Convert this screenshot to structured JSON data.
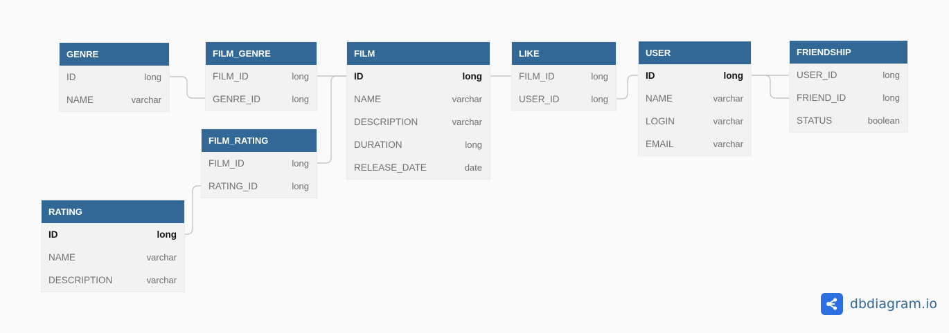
{
  "tables": {
    "genre": {
      "name": "GENRE",
      "fields": [
        {
          "name": "ID",
          "type": "long"
        },
        {
          "name": "NAME",
          "type": "varchar"
        }
      ]
    },
    "film_genre": {
      "name": "FILM_GENRE",
      "fields": [
        {
          "name": "FILM_ID",
          "type": "long"
        },
        {
          "name": "GENRE_ID",
          "type": "long"
        }
      ]
    },
    "film_rating": {
      "name": "FILM_RATING",
      "fields": [
        {
          "name": "FILM_ID",
          "type": "long"
        },
        {
          "name": "RATING_ID",
          "type": "long"
        }
      ]
    },
    "rating": {
      "name": "RATING",
      "fields": [
        {
          "name": "ID",
          "type": "long"
        },
        {
          "name": "NAME",
          "type": "varchar"
        },
        {
          "name": "DESCRIPTION",
          "type": "varchar"
        }
      ]
    },
    "film": {
      "name": "FILM",
      "fields": [
        {
          "name": "ID",
          "type": "long"
        },
        {
          "name": "NAME",
          "type": "varchar"
        },
        {
          "name": "DESCRIPTION",
          "type": "varchar"
        },
        {
          "name": "DURATION",
          "type": "long"
        },
        {
          "name": "RELEASE_DATE",
          "type": "date"
        }
      ]
    },
    "like": {
      "name": "LIKE",
      "fields": [
        {
          "name": "FILM_ID",
          "type": "long"
        },
        {
          "name": "USER_ID",
          "type": "long"
        }
      ]
    },
    "user": {
      "name": "USER",
      "fields": [
        {
          "name": "ID",
          "type": "long"
        },
        {
          "name": "NAME",
          "type": "varchar"
        },
        {
          "name": "LOGIN",
          "type": "varchar"
        },
        {
          "name": "EMAIL",
          "type": "varchar"
        }
      ]
    },
    "friendship": {
      "name": "FRIENDSHIP",
      "fields": [
        {
          "name": "USER_ID",
          "type": "long"
        },
        {
          "name": "FRIEND_ID",
          "type": "long"
        },
        {
          "name": "STATUS",
          "type": "boolean"
        }
      ]
    }
  },
  "brand": {
    "text": "dbdiagram.io",
    "icon": "share-nodes-icon",
    "color": "#2b6fe0"
  },
  "colors": {
    "header": "#316896",
    "body": "#f2f2f2",
    "connector": "#bdbdbd",
    "background": "#fafafa"
  }
}
